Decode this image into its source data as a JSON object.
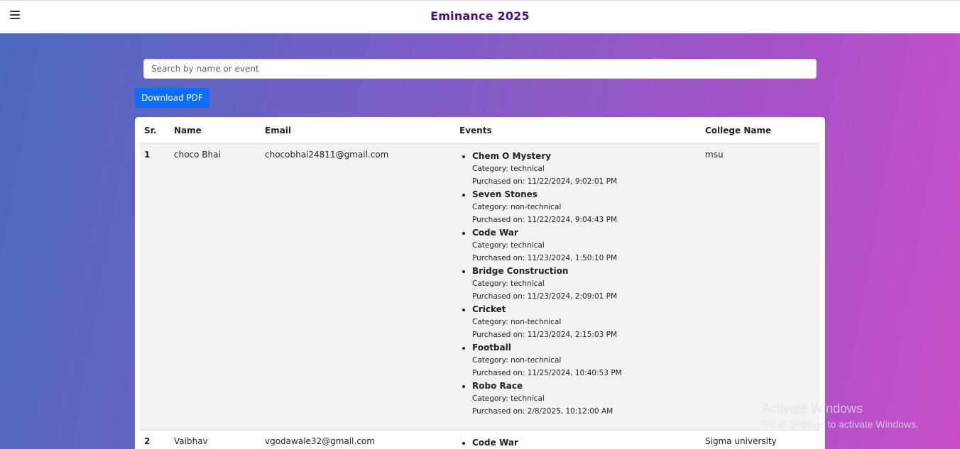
{
  "header": {
    "title": "Eminance 2025",
    "menu_icon": "hamburger-menu-icon"
  },
  "search": {
    "placeholder": "Search by name or event",
    "value": ""
  },
  "toolbar": {
    "download_label": "Download PDF"
  },
  "table": {
    "columns": {
      "sr": "Sr.",
      "name": "Name",
      "email": "Email",
      "events": "Events",
      "college": "College Name"
    },
    "rows": [
      {
        "sr": "1",
        "name": "choco Bhai",
        "email": "chocobhai24811@gmail.com",
        "college": "msu",
        "events": [
          {
            "name": "Chem O Mystery",
            "category": "Category: technical",
            "purchased": "Purchased on: 11/22/2024, 9:02:01 PM"
          },
          {
            "name": "Seven Stones",
            "category": "Category: non-technical",
            "purchased": "Purchased on: 11/22/2024, 9:04:43 PM"
          },
          {
            "name": "Code War",
            "category": "Category: technical",
            "purchased": "Purchased on: 11/23/2024, 1:50:10 PM"
          },
          {
            "name": "Bridge Construction",
            "category": "Category: technical",
            "purchased": "Purchased on: 11/23/2024, 2:09:01 PM"
          },
          {
            "name": "Cricket",
            "category": "Category: non-technical",
            "purchased": "Purchased on: 11/23/2024, 2:15:03 PM"
          },
          {
            "name": "Football",
            "category": "Category: non-technical",
            "purchased": "Purchased on: 11/25/2024, 10:40:53 PM"
          },
          {
            "name": "Robo Race",
            "category": "Category: technical",
            "purchased": "Purchased on: 2/8/2025, 10:12:00 AM"
          }
        ]
      },
      {
        "sr": "2",
        "name": "Vaibhav",
        "email": "vgodawale32@gmail.com",
        "college": "Sigma university",
        "events": [
          {
            "name": "Code War",
            "category": "",
            "purchased": ""
          }
        ]
      }
    ]
  },
  "watermark": {
    "title": "Activate Windows",
    "subtitle": "Go to Settings to activate Windows."
  }
}
